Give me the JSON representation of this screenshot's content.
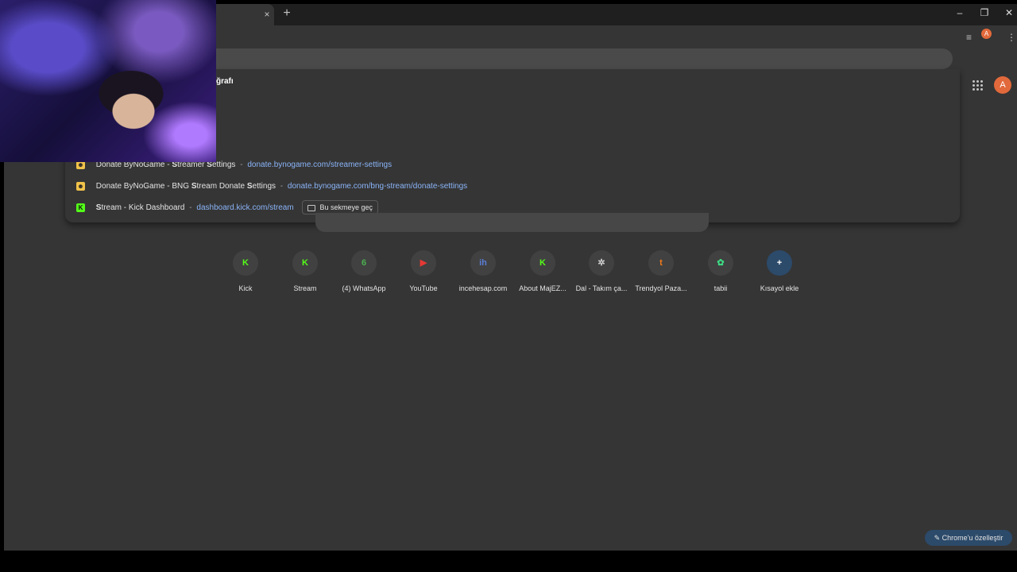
{
  "window": {
    "minimize_icon": "–",
    "restore_icon": "❐",
    "close_icon": "✕"
  },
  "tab": {
    "close_icon": "×",
    "new_tab_icon": "+"
  },
  "toolbar": {
    "media_icon": "≡",
    "avatar_letter": "A",
    "menu_icon": "⋮"
  },
  "omnibox_dropdown": {
    "partial_header": "ğrafı",
    "suggestions": [
      {
        "icon": "bynogame-icon",
        "title_parts": [
          "Donate ByNoGame - ",
          "S",
          "treamer ",
          "S",
          "ettings"
        ],
        "separator": "-",
        "url": "donate.bynogame.com/streamer-settings"
      },
      {
        "icon": "bynogame-icon",
        "title_parts": [
          "Donate ByNoGame - BNG ",
          "S",
          "tream Donate ",
          "S",
          "ettings"
        ],
        "separator": "-",
        "url": "donate.bynogame.com/bng-stream/donate-settings"
      },
      {
        "icon": "kick-icon",
        "title_parts": [
          "S",
          "tream - Kick Dashboard"
        ],
        "separator": "-",
        "url": "dashboard.kick.com/stream",
        "action_label": "Bu sekmeye geç"
      }
    ]
  },
  "header_right": {
    "avatar_letter": "A"
  },
  "shortcuts": [
    {
      "label": "Kick",
      "icon": "kick-icon",
      "glyph": "K",
      "color": "#53fc18"
    },
    {
      "label": "Stream",
      "icon": "kick-icon",
      "glyph": "K",
      "color": "#53fc18"
    },
    {
      "label": "(4) WhatsApp",
      "icon": "whatsapp-icon",
      "glyph": "6",
      "color": "#4caf50"
    },
    {
      "label": "YouTube",
      "icon": "youtube-icon",
      "glyph": "▶",
      "color": "#e53935"
    },
    {
      "label": "incehesap.com",
      "icon": "incehesap-icon",
      "glyph": "ih",
      "color": "#5b7fd6"
    },
    {
      "label": "About MajEZ...",
      "icon": "kick-icon",
      "glyph": "K",
      "color": "#53fc18"
    },
    {
      "label": "Dal - Takım ça...",
      "icon": "openai-icon",
      "glyph": "✲",
      "color": "#d0d0d0"
    },
    {
      "label": "Trendyol Paza...",
      "icon": "trendyol-icon",
      "glyph": "t",
      "color": "#f27a1a"
    },
    {
      "label": "tabii",
      "icon": "tabii-icon",
      "glyph": "✿",
      "color": "#3ddc84"
    },
    {
      "label": "Kısayol ekle",
      "icon": "add-shortcut-icon",
      "glyph": "+",
      "color": "#ffffff"
    }
  ],
  "customize_button": {
    "icon": "pencil-icon",
    "label": "Chrome'u özelleştir"
  }
}
